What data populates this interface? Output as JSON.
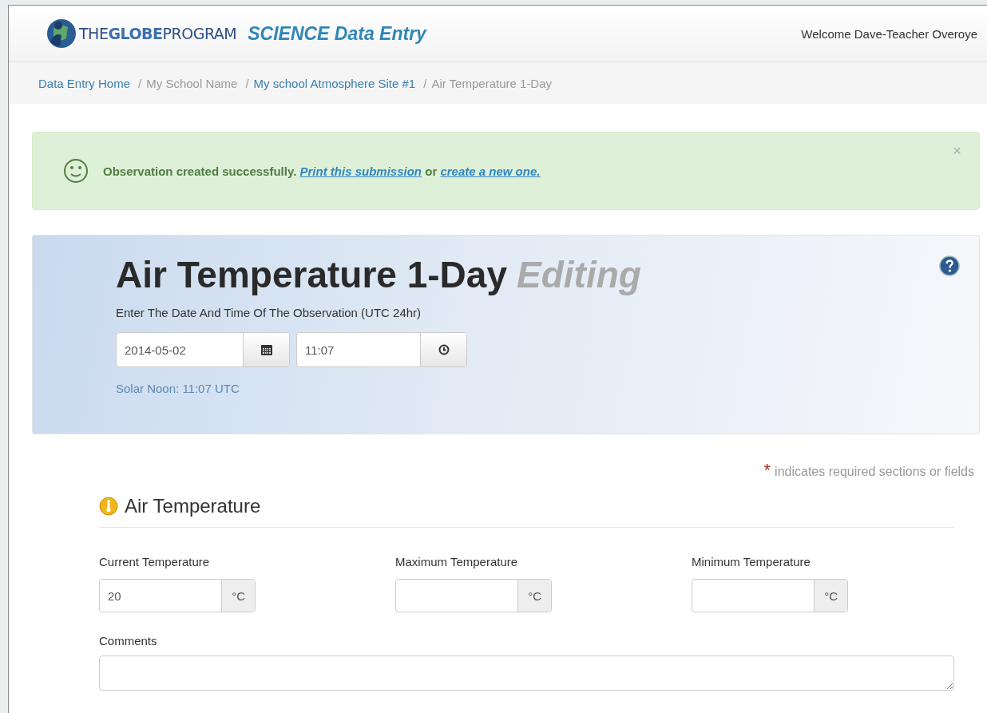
{
  "header": {
    "logo": "THE**GLOBE**PROGRAM",
    "title": "SCIENCE Data Entry",
    "welcome": "Welcome Dave-Teacher Overoye"
  },
  "breadcrumb": [
    {
      "label": "Data Entry Home",
      "link": true
    },
    {
      "separator": "/",
      "label": "My School Name",
      "link": false
    },
    {
      "separator": "/",
      "label": "My school Atmosphere Site #1",
      "link": true
    },
    {
      "separator": "/",
      "label": "Air Temperature 1-Day",
      "link": false
    }
  ],
  "alert": {
    "message": "Observation created successfully.",
    "link_1": "Print this submission",
    "joiner": "or",
    "link_2": "create a new one.",
    "close": "×"
  },
  "panel": {
    "title": "Air Temperature 1-Day",
    "mode": "Editing",
    "prompt": "Enter The Date And Time Of The Observation (UTC 24hr)",
    "date": "2014-05-02",
    "time": "11:07",
    "solar_noon": "Solar Noon: 11:07 UTC"
  },
  "required_note": {
    "mark": "*",
    "text": "indicates required sections or fields"
  },
  "section": {
    "title": "Air Temperature",
    "fields": [
      {
        "label": "Current Temperature",
        "value": "20",
        "unit": "°C"
      },
      {
        "label": "Maximum Temperature",
        "unit": "°C"
      },
      {
        "label": "Minimum Temperature",
        "unit": "°C"
      }
    ],
    "comments_label": "Comments"
  }
}
